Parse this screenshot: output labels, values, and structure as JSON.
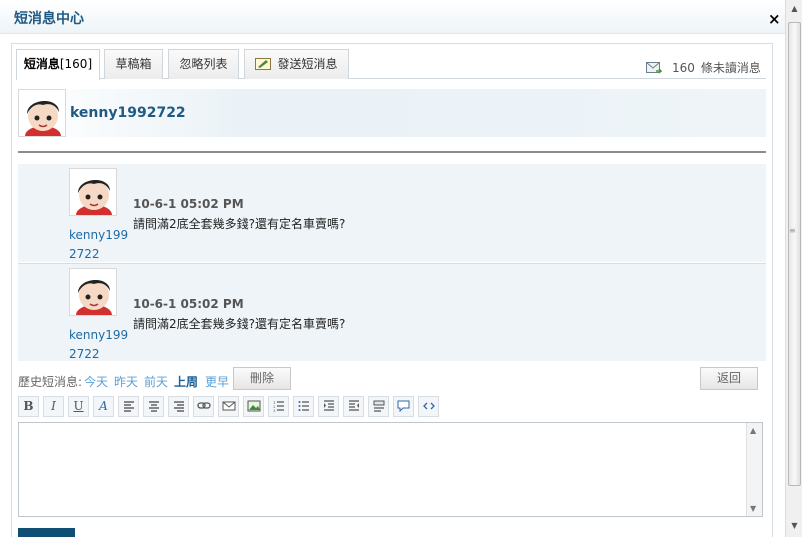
{
  "window": {
    "title": "短消息中心",
    "close_label": "×"
  },
  "tabs": [
    {
      "label": "短消息",
      "count": "[160]"
    },
    {
      "label": "草稿箱"
    },
    {
      "label": "忽略列表"
    },
    {
      "label": "發送短消息"
    }
  ],
  "unread": {
    "count": "160",
    "label": "條未讀消息"
  },
  "partner": {
    "name": "kenny1992722"
  },
  "messages": [
    {
      "user_line1": "kenny199",
      "user_line2": "2722",
      "time": "10-6-1 05:02 PM",
      "text": "請問滿2底全套幾多錢?還有定名車賣嗎?"
    },
    {
      "user_line1": "kenny199",
      "user_line2": "2722",
      "time": "10-6-1 05:02 PM",
      "text": "請問滿2底全套幾多錢?還有定名車賣嗎?"
    }
  ],
  "history": {
    "label": "歷史短消息:",
    "links": [
      "今天",
      "昨天",
      "前天",
      "上周",
      "更早"
    ],
    "delete_label": "刪除",
    "back_label": "返回"
  },
  "toolbar": {
    "bold": "B",
    "italic": "I",
    "underline": "U",
    "color": "A"
  },
  "editor": {
    "value": ""
  },
  "colors": {
    "accent": "#1f5a83",
    "link": "#5b9fd6",
    "panel_bg": "#eef4f8",
    "submit": "#0f4f74"
  }
}
